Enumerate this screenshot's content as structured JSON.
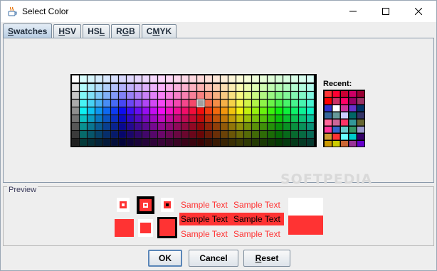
{
  "window": {
    "title": "Select Color"
  },
  "tabs": [
    {
      "pre": "",
      "mnemonic": "S",
      "post": "watches",
      "selected": true
    },
    {
      "pre": "",
      "mnemonic": "H",
      "post": "SV",
      "selected": false
    },
    {
      "pre": "HS",
      "mnemonic": "L",
      "post": "",
      "selected": false
    },
    {
      "pre": "R",
      "mnemonic": "G",
      "post": "B",
      "selected": false
    },
    {
      "pre": "C",
      "mnemonic": "M",
      "post": "YK",
      "selected": false
    }
  ],
  "recent": {
    "label": "Recent:"
  },
  "preview": {
    "label": "Preview",
    "sample_text_1": "Sample Text",
    "sample_text_2": "Sample Text"
  },
  "buttons": {
    "ok": "OK",
    "cancel": "Cancel",
    "reset_pre": "",
    "reset_mnemonic": "R",
    "reset_post": "eset"
  },
  "watermark": "SOFTPEDIA",
  "colors": {
    "preview_color": "#ff3333",
    "recent_colors": [
      "#ff3333",
      "#ff0033",
      "#cc0033",
      "#cc0066",
      "#990033",
      "#ff0000",
      "#cc3366",
      "#ff0066",
      "#990066",
      "#993366",
      "#3333cc",
      "#ffffff",
      "#cc3399",
      "#6633cc",
      "#003366",
      "#336699",
      "#669999",
      "#ccccff",
      "#006666",
      "#333366",
      "#ff6699",
      "#cc6699",
      "#ff3366",
      "#339999",
      "#666633",
      "#ff3399",
      "#3366cc",
      "#66cccc",
      "#339966",
      "#9999cc",
      "#cc9933",
      "#ff3333",
      "#66ffff",
      "#00cccc",
      "#330066",
      "#cc9900",
      "#cccc00",
      "#cc6633",
      "#993399",
      "#6600cc"
    ]
  }
}
